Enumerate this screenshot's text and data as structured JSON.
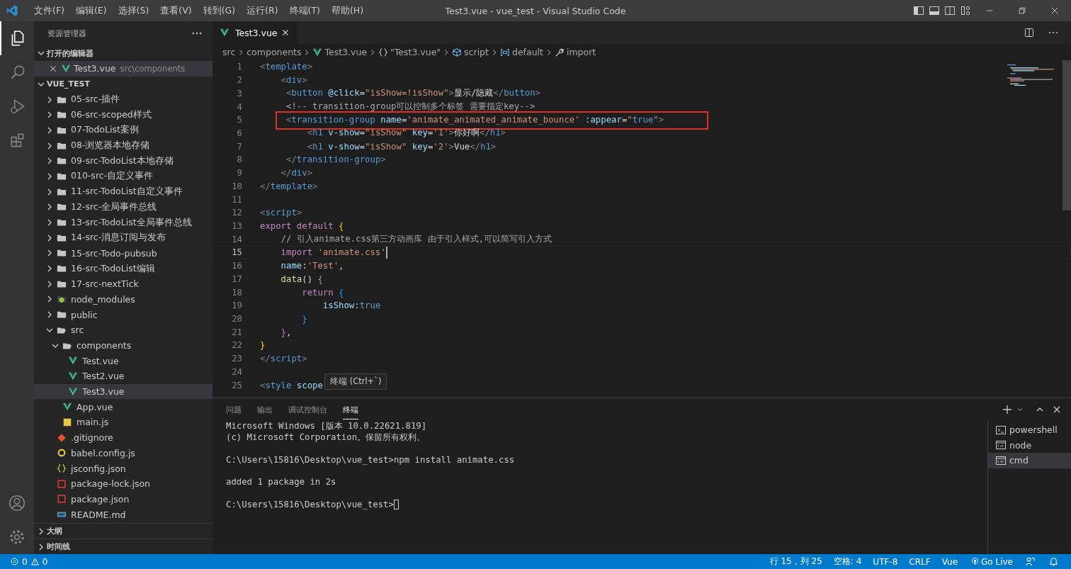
{
  "window": {
    "title": "Test3.vue - vue_test - Visual Studio Code"
  },
  "menu": [
    "文件(F)",
    "编辑(E)",
    "选择(S)",
    "查看(V)",
    "转到(G)",
    "运行(R)",
    "终端(T)",
    "帮助(H)"
  ],
  "activity_bar": [
    {
      "kind": "explorer",
      "selected": true
    },
    {
      "kind": "search",
      "selected": false
    },
    {
      "kind": "run",
      "selected": false
    },
    {
      "kind": "extensions",
      "selected": false
    }
  ],
  "explorer": {
    "title": "资源管理器",
    "open_editors": {
      "title": "打开的编辑器",
      "expanded": true,
      "items": [
        {
          "name": "Test3.vue",
          "path": "src\\components",
          "kind": "vue",
          "selected": true
        }
      ]
    },
    "project": {
      "title": "VUE_TEST",
      "expanded": true,
      "children": [
        {
          "name": "05-src-插件",
          "kind": "folder",
          "expanded": false,
          "selected": false
        },
        {
          "name": "06-src-scoped样式",
          "kind": "folder",
          "expanded": false,
          "selected": false
        },
        {
          "name": "07-TodoList案例",
          "kind": "folder",
          "expanded": false,
          "selected": false
        },
        {
          "name": "08-浏览器本地存储",
          "kind": "folder",
          "expanded": false,
          "selected": false
        },
        {
          "name": "09-src-TodoList本地存储",
          "kind": "folder",
          "expanded": false,
          "selected": false
        },
        {
          "name": "010-src-自定义事件",
          "kind": "folder",
          "expanded": false,
          "selected": false
        },
        {
          "name": "11-src-TodoList自定义事件",
          "kind": "folder",
          "expanded": false,
          "selected": false
        },
        {
          "name": "12-src-全局事件总线",
          "kind": "folder",
          "expanded": false,
          "selected": false
        },
        {
          "name": "13-src-TodoList全局事件总线",
          "kind": "folder",
          "expanded": false,
          "selected": false
        },
        {
          "name": "14-src-消息订阅与发布",
          "kind": "folder",
          "expanded": false,
          "selected": false
        },
        {
          "name": "15-src-Todo-pubsub",
          "kind": "folder",
          "expanded": false,
          "selected": false
        },
        {
          "name": "16-src-TodoList编辑",
          "kind": "folder",
          "expanded": false,
          "selected": false
        },
        {
          "name": "17-src-nextTick",
          "kind": "folder",
          "expanded": false,
          "selected": false
        },
        {
          "name": "node_modules",
          "kind": "node-folder",
          "expanded": false,
          "selected": false
        },
        {
          "name": "public",
          "kind": "folder",
          "expanded": false,
          "selected": false
        },
        {
          "name": "src",
          "kind": "folder",
          "expanded": true,
          "selected": false,
          "children": [
            {
              "name": "components",
              "kind": "folder",
              "expanded": true,
              "selected": false,
              "children": [
                {
                  "name": "Test.vue",
                  "kind": "vue",
                  "selected": false
                },
                {
                  "name": "Test2.vue",
                  "kind": "vue",
                  "selected": false
                },
                {
                  "name": "Test3.vue",
                  "kind": "vue",
                  "selected": true
                }
              ]
            },
            {
              "name": "App.vue",
              "kind": "vue",
              "selected": false
            },
            {
              "name": "main.js",
              "kind": "js",
              "selected": false
            }
          ]
        },
        {
          "name": ".gitignore",
          "kind": "git",
          "selected": false
        },
        {
          "name": "babel.config.js",
          "kind": "babel",
          "selected": false
        },
        {
          "name": "jsconfig.json",
          "kind": "json",
          "selected": false
        },
        {
          "name": "package-lock.json",
          "kind": "npm",
          "selected": false
        },
        {
          "name": "package.json",
          "kind": "npm",
          "selected": false
        },
        {
          "name": "README.md",
          "kind": "md",
          "selected": false
        }
      ]
    },
    "outline": {
      "title": "大纲",
      "expanded": false
    },
    "timeline": {
      "title": "时间线",
      "expanded": false
    }
  },
  "tabs": [
    {
      "label": "Test3.vue",
      "kind": "vue",
      "selected": true
    }
  ],
  "breadcrumbs": [
    {
      "label": "src",
      "kind": "text"
    },
    {
      "label": "components",
      "kind": "text"
    },
    {
      "label": "Test3.vue",
      "kind": "vue"
    },
    {
      "label": "\"Test3.vue\"",
      "kind": "braces"
    },
    {
      "label": "script",
      "kind": "module"
    },
    {
      "label": "default",
      "kind": "variable"
    },
    {
      "label": "import",
      "kind": "wrench"
    }
  ],
  "code": [
    {
      "number": "1",
      "tokens": [
        {
          "t": "<",
          "kind": "punct"
        },
        {
          "t": "template",
          "kind": "tag"
        },
        {
          "t": ">",
          "kind": "punct"
        }
      ]
    },
    {
      "number": "2",
      "tokens": [
        {
          "t": "    <",
          "kind": "punct"
        },
        {
          "t": "div",
          "kind": "tag"
        },
        {
          "t": ">",
          "kind": "punct"
        }
      ]
    },
    {
      "number": "3",
      "tokens": [
        {
          "t": "     <",
          "kind": "punct"
        },
        {
          "t": "button",
          "kind": "tag"
        },
        {
          "t": " @click",
          "kind": "attr"
        },
        {
          "t": "=",
          "kind": "text"
        },
        {
          "t": "\"isShow=!isShow\"",
          "kind": "str"
        },
        {
          "t": ">",
          "kind": "punct"
        },
        {
          "t": "显示/隐藏",
          "kind": "text"
        },
        {
          "t": "</",
          "kind": "punct"
        },
        {
          "t": "button",
          "kind": "tag"
        },
        {
          "t": ">",
          "kind": "punct"
        }
      ]
    },
    {
      "number": "4",
      "tokens": [
        {
          "t": "     <!-- transition-group可以控制多个标签 需要指定key-->",
          "kind": "comment"
        }
      ]
    },
    {
      "number": "5",
      "highlighted": true,
      "tokens": [
        {
          "t": "     <",
          "kind": "punct"
        },
        {
          "t": "transition-group",
          "kind": "tag"
        },
        {
          "t": " name",
          "kind": "attr"
        },
        {
          "t": "=",
          "kind": "text"
        },
        {
          "t": "'animate_animated_animate_bounce'",
          "kind": "str"
        },
        {
          "t": " :appear",
          "kind": "attr"
        },
        {
          "t": "=",
          "kind": "text"
        },
        {
          "t": "\"",
          "kind": "str"
        },
        {
          "t": "true",
          "kind": "bool"
        },
        {
          "t": "\"",
          "kind": "str"
        },
        {
          "t": ">",
          "kind": "punct"
        }
      ]
    },
    {
      "number": "6",
      "tokens": [
        {
          "t": "         <",
          "kind": "punct"
        },
        {
          "t": "h1",
          "kind": "tag"
        },
        {
          "t": " v-show",
          "kind": "attr"
        },
        {
          "t": "=",
          "kind": "text"
        },
        {
          "t": "\"isShow\"",
          "kind": "str"
        },
        {
          "t": " key",
          "kind": "attr"
        },
        {
          "t": "=",
          "kind": "text"
        },
        {
          "t": "'1'",
          "kind": "str"
        },
        {
          "t": ">",
          "kind": "punct"
        },
        {
          "t": "你好啊",
          "kind": "text"
        },
        {
          "t": "</",
          "kind": "punct"
        },
        {
          "t": "h1",
          "kind": "tag"
        },
        {
          "t": ">",
          "kind": "punct"
        }
      ]
    },
    {
      "number": "7",
      "tokens": [
        {
          "t": "         <",
          "kind": "punct"
        },
        {
          "t": "h1",
          "kind": "tag"
        },
        {
          "t": " v-show",
          "kind": "attr"
        },
        {
          "t": "=",
          "kind": "text"
        },
        {
          "t": "\"isShow\"",
          "kind": "str"
        },
        {
          "t": " key",
          "kind": "attr"
        },
        {
          "t": "=",
          "kind": "text"
        },
        {
          "t": "'2'",
          "kind": "str"
        },
        {
          "t": ">",
          "kind": "punct"
        },
        {
          "t": "Vue",
          "kind": "text"
        },
        {
          "t": "</",
          "kind": "punct"
        },
        {
          "t": "h1",
          "kind": "tag"
        },
        {
          "t": ">",
          "kind": "punct"
        }
      ]
    },
    {
      "number": "8",
      "tokens": [
        {
          "t": "     </",
          "kind": "punct"
        },
        {
          "t": "transition-group",
          "kind": "tag"
        },
        {
          "t": ">",
          "kind": "punct"
        }
      ]
    },
    {
      "number": "9",
      "tokens": [
        {
          "t": "    </",
          "kind": "punct"
        },
        {
          "t": "div",
          "kind": "tag"
        },
        {
          "t": ">",
          "kind": "punct"
        }
      ]
    },
    {
      "number": "10",
      "tokens": [
        {
          "t": "</",
          "kind": "punct"
        },
        {
          "t": "template",
          "kind": "tag"
        },
        {
          "t": ">",
          "kind": "punct"
        }
      ]
    },
    {
      "number": "11"
    },
    {
      "number": "12",
      "tokens": [
        {
          "t": "<",
          "kind": "punct"
        },
        {
          "t": "script",
          "kind": "tag"
        },
        {
          "t": ">",
          "kind": "punct"
        }
      ]
    },
    {
      "number": "13",
      "tokens": [
        {
          "t": "export default ",
          "kind": "kw"
        },
        {
          "t": "{",
          "kind": "bracket1"
        }
      ]
    },
    {
      "number": "14",
      "tokens": [
        {
          "t": "    // 引入animate.css第三方动画库 由于引入样式,可以简写引入方式",
          "kind": "comment"
        }
      ]
    },
    {
      "number": "15",
      "current": true,
      "tokens": [
        {
          "t": "    import ",
          "kind": "kw"
        },
        {
          "t": "'animate.css'",
          "kind": "str"
        }
      ]
    },
    {
      "number": "16",
      "tokens": [
        {
          "t": "    name",
          "kind": "attr"
        },
        {
          "t": ":",
          "kind": "text"
        },
        {
          "t": "'Test'",
          "kind": "str"
        },
        {
          "t": ",",
          "kind": "text"
        }
      ]
    },
    {
      "number": "17",
      "tokens": [
        {
          "t": "    data",
          "kind": "fn"
        },
        {
          "t": "() ",
          "kind": "text"
        },
        {
          "t": "{",
          "kind": "bracket2"
        }
      ]
    },
    {
      "number": "18",
      "tokens": [
        {
          "t": "        return ",
          "kind": "kw"
        },
        {
          "t": "{",
          "kind": "bracket3"
        }
      ]
    },
    {
      "number": "19",
      "tokens": [
        {
          "t": "            isShow",
          "kind": "attr"
        },
        {
          "t": ":",
          "kind": "text"
        },
        {
          "t": "true",
          "kind": "bool"
        }
      ]
    },
    {
      "number": "20",
      "tokens": [
        {
          "t": "        }",
          "kind": "bracket3"
        }
      ]
    },
    {
      "number": "21",
      "tokens": [
        {
          "t": "    }",
          "kind": "bracket2"
        },
        {
          "t": ",",
          "kind": "text"
        }
      ]
    },
    {
      "number": "22",
      "tokens": [
        {
          "t": "}",
          "kind": "bracket1"
        }
      ]
    },
    {
      "number": "23",
      "tokens": [
        {
          "t": "</",
          "kind": "punct"
        },
        {
          "t": "script",
          "kind": "tag"
        },
        {
          "t": ">",
          "kind": "punct"
        }
      ]
    },
    {
      "number": "24"
    },
    {
      "number": "25",
      "tokens": [
        {
          "t": "<",
          "kind": "punct"
        },
        {
          "t": "style",
          "kind": "tag"
        },
        {
          "t": " scope",
          "kind": "attr"
        }
      ]
    }
  ],
  "tooltip": "终端 (Ctrl+`)",
  "panel": {
    "tabs": [
      {
        "label": "问题",
        "selected": false
      },
      {
        "label": "输出",
        "selected": false
      },
      {
        "label": "调试控制台",
        "selected": false
      },
      {
        "label": "终端",
        "selected": true
      }
    ],
    "terminal_blocks": [
      [
        "Microsoft Windows [版本 10.0.22621.819]",
        "(c) Microsoft Corporation。保留所有权利。"
      ],
      [
        "C:\\Users\\15816\\Desktop\\vue_test>npm install animate.css"
      ],
      [
        "added 1 package in 2s"
      ],
      [
        "C:\\Users\\15816\\Desktop\\vue_test>"
      ]
    ],
    "terminals": [
      {
        "label": "powershell",
        "kind": "powershell",
        "selected": false
      },
      {
        "label": "node",
        "kind": "cmd",
        "selected": false
      },
      {
        "label": "cmd",
        "kind": "cmd",
        "selected": true
      }
    ]
  },
  "status_bar": {
    "errors": "0",
    "warnings": "0",
    "items": [
      {
        "label": "行 15，列 25",
        "kind": "text"
      },
      {
        "label": "空格: 4",
        "kind": "text"
      },
      {
        "label": "UTF-8",
        "kind": "text"
      },
      {
        "label": "CRLF",
        "kind": "text"
      },
      {
        "label": "Vue",
        "kind": "text"
      },
      {
        "label": "Go Live",
        "kind": "golive"
      }
    ]
  }
}
